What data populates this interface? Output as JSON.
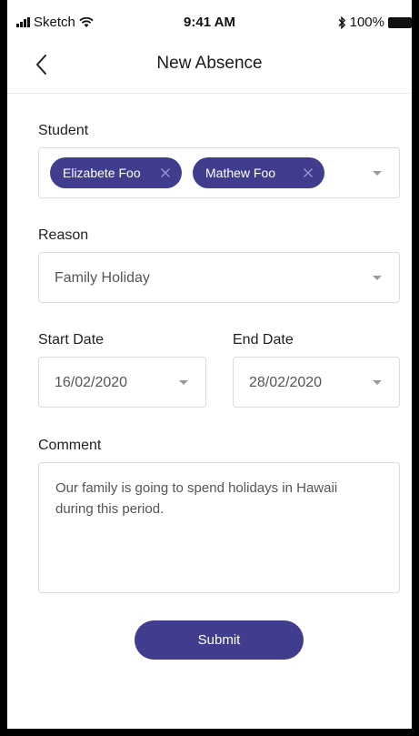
{
  "status_bar": {
    "carrier": "Sketch",
    "time": "9:41 AM",
    "battery": "100%"
  },
  "header": {
    "title": "New Absence"
  },
  "form": {
    "student": {
      "label": "Student",
      "chips": [
        {
          "label": "Elizabete Foo"
        },
        {
          "label": "Mathew Foo"
        }
      ]
    },
    "reason": {
      "label": "Reason",
      "value": "Family Holiday"
    },
    "start_date": {
      "label": "Start Date",
      "value": "16/02/2020"
    },
    "end_date": {
      "label": "End Date",
      "value": "28/02/2020"
    },
    "comment": {
      "label": "Comment",
      "value": "Our family is going to spend holidays in Hawaii during this period."
    },
    "submit_label": "Submit"
  },
  "colors": {
    "accent": "#403d8e",
    "border": "#dcdcdc",
    "text": "#1f1f1f"
  }
}
